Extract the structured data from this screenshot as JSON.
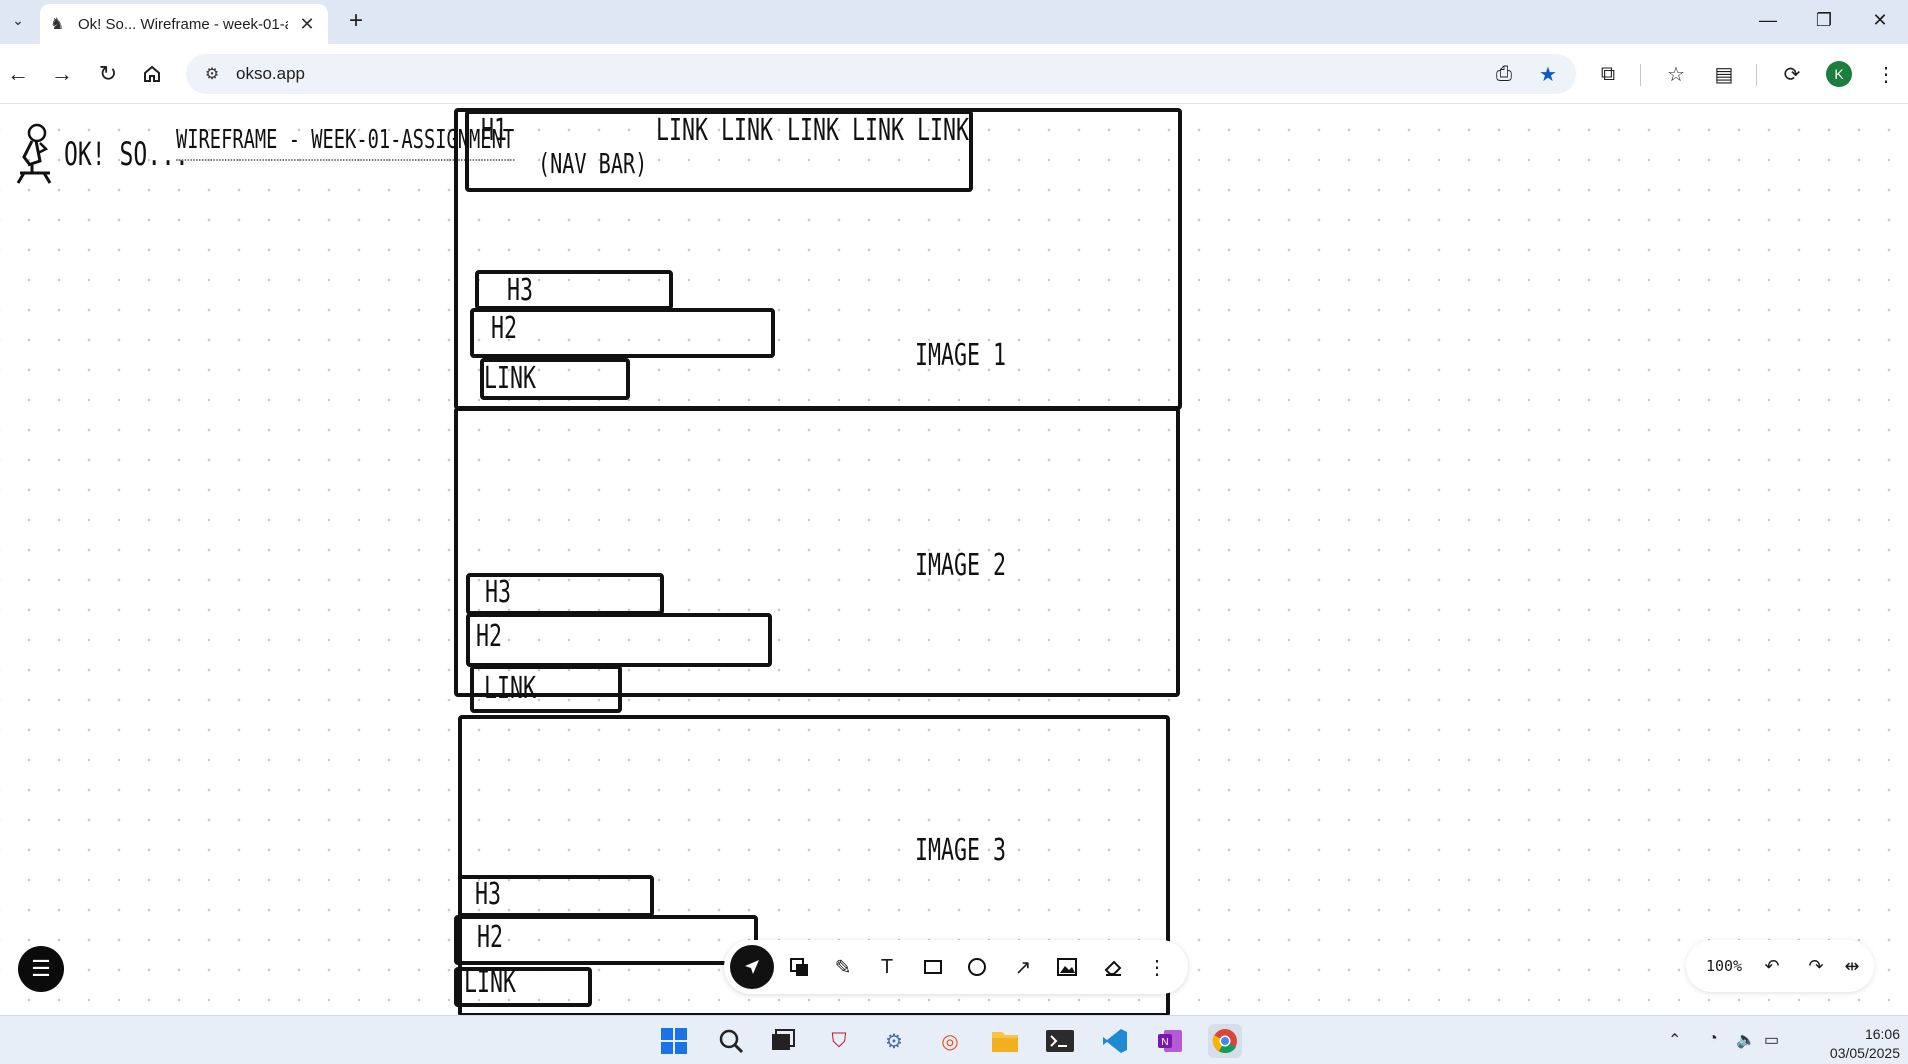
{
  "browser": {
    "tab_title": "Ok! So... Wireframe - week-01-a",
    "new_tab_label": "+",
    "url": "okso.app"
  },
  "app": {
    "brand": "OK! SO...",
    "document_title": "WIREFRAME - WEEK-01-ASSIGNMENT"
  },
  "wireframe": {
    "nav": {
      "h1": "H1",
      "nav_note": "(NAV BAR)",
      "links": [
        "LINK",
        "LINK",
        "LINK",
        "LINK",
        "LINK"
      ]
    },
    "sections": [
      {
        "image": "IMAGE 1",
        "h3": "H3",
        "h2": "H2",
        "link": "LINK"
      },
      {
        "image": "IMAGE 2",
        "h3": "H3",
        "h2": "H2",
        "link": "LINK"
      },
      {
        "image": "IMAGE 3",
        "h3": "H3",
        "h2": "H2",
        "link": "LINK"
      }
    ]
  },
  "drawing_toolbar": {
    "tools": [
      "select-tool",
      "shapes-tool",
      "pen-tool",
      "text-tool",
      "rectangle-tool",
      "ellipse-tool",
      "arrow-tool",
      "image-tool",
      "eraser-tool",
      "more-tool"
    ],
    "active": "select-tool",
    "glyphs": {
      "text": "T",
      "more": "⋮"
    }
  },
  "zoom": {
    "level": "100%"
  },
  "taskbar": {
    "time": "16:06",
    "date": "03/05/2025"
  },
  "colors": {
    "accent": "#0b57d0",
    "ink": "#111111",
    "avatar": "#1a7f3c"
  },
  "avatar_initial": "K"
}
